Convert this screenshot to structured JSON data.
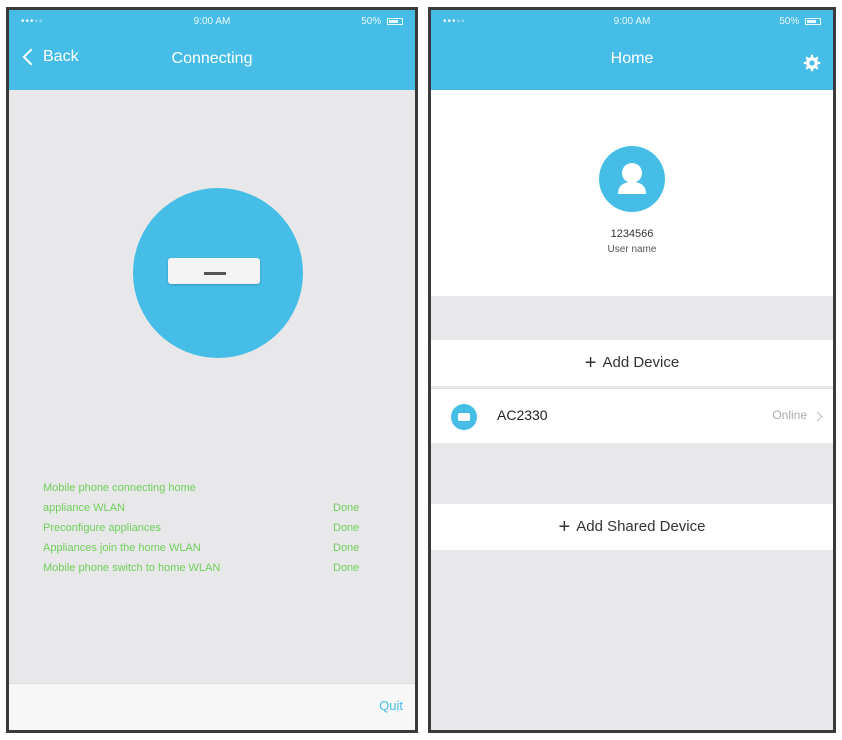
{
  "left_screen": {
    "status_bar": {
      "signal": "•••◦◦",
      "time": "9:00 AM",
      "battery": "50%"
    },
    "nav": {
      "back_label": "Back",
      "title": "Connecting"
    },
    "steps": [
      {
        "label": "Mobile phone connecting home",
        "status": ""
      },
      {
        "label": "appliance WLAN",
        "status": "Done"
      },
      {
        "label": "Preconfigure appliances",
        "status": "Done"
      },
      {
        "label": "Appliances join the home WLAN",
        "status": "Done"
      },
      {
        "label": "Mobile phone switch to home WLAN",
        "status": "Done"
      }
    ],
    "bottom": {
      "quit_label": "Quit"
    }
  },
  "right_screen": {
    "status_bar": {
      "signal": "•••◦◦",
      "time": "9:00 AM",
      "battery": "50%"
    },
    "nav": {
      "title": "Home",
      "settings_icon": "gear-icon"
    },
    "profile": {
      "user_id": "1234566",
      "user_name": "User name",
      "avatar_icon": "user-icon"
    },
    "add_device_label": "Add Device",
    "devices": [
      {
        "name": "AC2330",
        "status": "Online",
        "icon": "ac-icon"
      }
    ],
    "add_shared_label": "Add Shared Device"
  },
  "colors": {
    "accent": "#45bde6",
    "success": "#6fcf5a",
    "background": "#e8e8ea"
  }
}
